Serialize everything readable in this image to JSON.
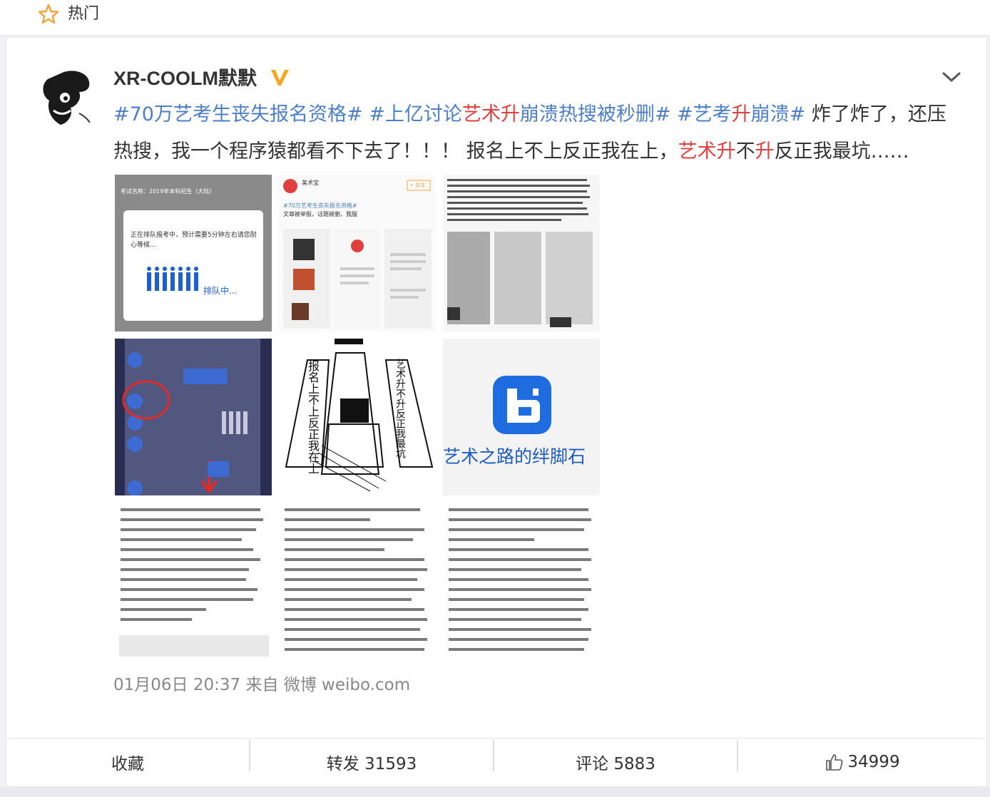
{
  "header": {
    "label": "热门",
    "icon": "star-icon"
  },
  "post": {
    "user": {
      "name": "XR-COOLM默默",
      "verified_icon": "vip-v-icon"
    },
    "text_segments": [
      {
        "t": "#70万艺考生丧失报名资格#",
        "c": "tag"
      },
      {
        "t": " ",
        "c": "plain"
      },
      {
        "t": "#上亿讨论",
        "c": "tag"
      },
      {
        "t": "艺术升",
        "c": "hl"
      },
      {
        "t": "崩溃热搜被秒删#",
        "c": "tag"
      },
      {
        "t": " ",
        "c": "plain"
      },
      {
        "t": "#艺考",
        "c": "tag"
      },
      {
        "t": "升",
        "c": "hl"
      },
      {
        "t": "崩溃#",
        "c": "tag"
      },
      {
        "t": " 炸了炸了，还压热搜，我一个程序猿都看不下去了！！！ 报名上不上反正我在上，",
        "c": "plain"
      },
      {
        "t": "艺术升",
        "c": "hl"
      },
      {
        "t": "不",
        "c": "plain"
      },
      {
        "t": "升",
        "c": "hl"
      },
      {
        "t": "反正我最坑……",
        "c": "plain"
      }
    ],
    "images": {
      "img1": {
        "top": "考试名称：2019年本科招生（大陆）",
        "dialog": "正在排队报考中，预计需要5分钟左右请您耐心等候…",
        "queue": "排队中..."
      },
      "img2": {
        "account": "美术宝",
        "follow": "+ 关注",
        "tag": "#70万艺考生丧失报名资格#",
        "line": "文章被举报，话题被删，我服"
      },
      "img3": {},
      "img4": {},
      "img5": {
        "left": "报名上不上反正我在上",
        "right": "艺术升不升反正我最坑"
      },
      "img6": {
        "slogan": "艺术之路的绊脚石"
      }
    },
    "meta": "01月06日 20:37 来自 微博 weibo.com"
  },
  "actions": {
    "favorite": "收藏",
    "repost": "转发 31593",
    "comment": "评论 5883",
    "like": "34999"
  },
  "colors": {
    "tag": "#4d7fc7",
    "highlight": "#e0403f",
    "star": "#f2a23a",
    "vip": "#f5a623"
  }
}
